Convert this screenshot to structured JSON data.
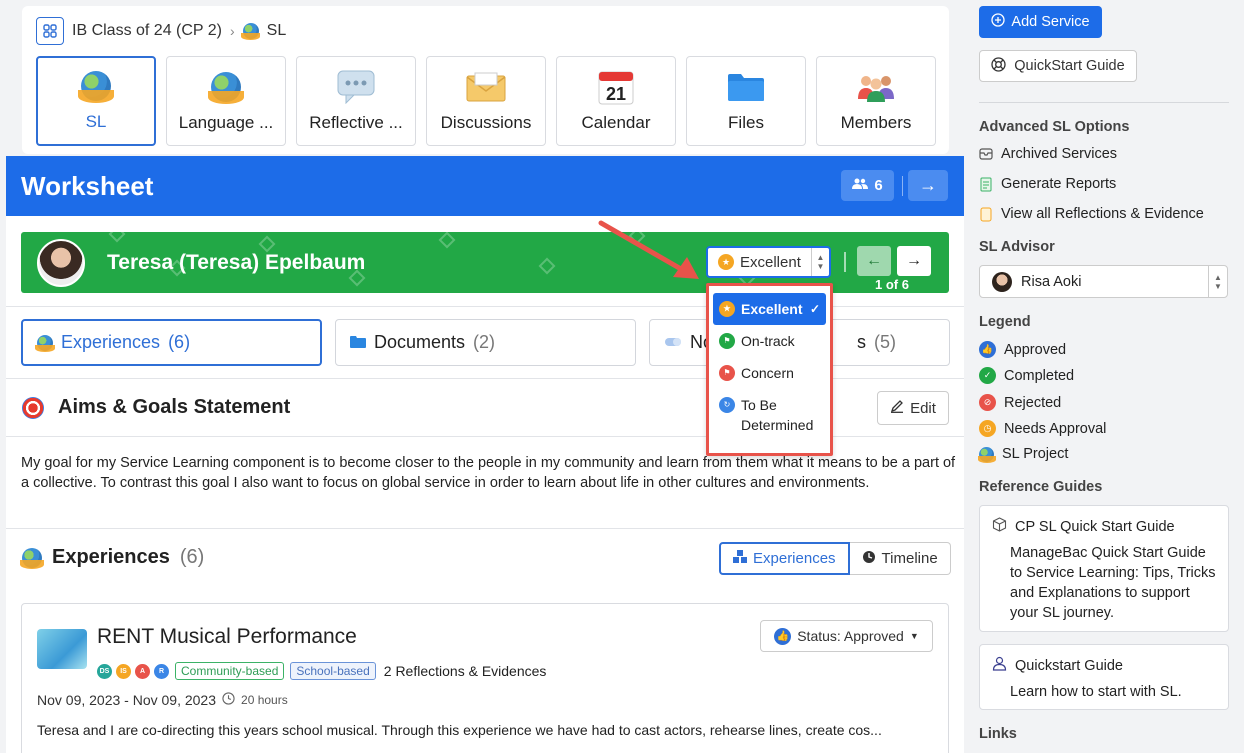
{
  "breadcrumb": {
    "class_name": "IB Class of 24 (CP 2)",
    "current": "SL"
  },
  "tabs": [
    {
      "label": "SL",
      "icon": "globe-hands-icon",
      "active": true
    },
    {
      "label": "Language ...",
      "icon": "globe-hands-icon"
    },
    {
      "label": "Reflective ...",
      "icon": "speech-bubble-icon"
    },
    {
      "label": "Discussions",
      "icon": "envelope-icon"
    },
    {
      "label": "Calendar",
      "icon": "calendar-icon",
      "calendar_day": "21"
    },
    {
      "label": "Files",
      "icon": "folder-icon"
    },
    {
      "label": "Members",
      "icon": "members-icon"
    }
  ],
  "worksheet": {
    "title": "Worksheet",
    "student_count": "6",
    "student": {
      "name": "Teresa (Teresa) Epelbaum",
      "grade_value": "Excellent",
      "pager": "1 of 6"
    },
    "subtabs": [
      {
        "label": "Experiences",
        "count": "(6)",
        "active": true
      },
      {
        "label": "Documents",
        "count": "(2)"
      },
      {
        "label": "No",
        "count": "(5)",
        "hidden_tail": "s"
      }
    ],
    "aims": {
      "title": "Aims & Goals Statement",
      "edit_label": "Edit",
      "text": "My goal for my Service Learning component is to become closer to the people in my community and learn from them what it means to be a part of a collective. To contrast this goal I also want to focus on global service in order to learn about life in other cultures and environments."
    },
    "experiences": {
      "title": "Experiences",
      "count": "(6)",
      "view_experiences": "Experiences",
      "view_timeline": "Timeline",
      "card": {
        "name": "RENT Musical Performance",
        "status": "Status: Approved",
        "initials": [
          "DS",
          "IS",
          "A",
          "R"
        ],
        "tags": [
          "Community-based",
          "School-based"
        ],
        "reflections": "2 Reflections & Evidences",
        "dates": "Nov 09, 2023 - Nov 09, 2023",
        "hours": "20 hours",
        "description": "Teresa and I are co-directing this years school musical. Through this experience we have had to cast actors, rehearse lines, create cos..."
      }
    }
  },
  "grade_dropdown": {
    "options": [
      {
        "label": "Excellent",
        "color": "#f5a623",
        "selected": true
      },
      {
        "label": "On-track",
        "color": "#22a846"
      },
      {
        "label": "Concern",
        "color": "#e8534a"
      },
      {
        "label": "To Be Determined",
        "color": "#3b86e6"
      }
    ]
  },
  "sidebar": {
    "add_service": "Add Service",
    "quickstart": "QuickStart Guide",
    "advanced_heading": "Advanced SL Options",
    "advanced_links": [
      "Archived Services",
      "Generate Reports",
      "View all Reflections & Evidence"
    ],
    "advisor_heading": "SL Advisor",
    "advisor_value": "Risa Aoki",
    "legend_heading": "Legend",
    "legend": [
      {
        "label": "Approved",
        "color": "#2f6fd6"
      },
      {
        "label": "Completed",
        "color": "#22a846"
      },
      {
        "label": "Rejected",
        "color": "#e8534a"
      },
      {
        "label": "Needs Approval",
        "color": "#f5a623"
      },
      {
        "label": "SL Project",
        "color": "#3a8fd6"
      }
    ],
    "reference_heading": "Reference Guides",
    "ref_cards": [
      {
        "title": "CP SL Quick Start Guide",
        "body": "ManageBac Quick Start Guide to Service Learning: Tips, Tricks and Explanations to support your SL journey."
      },
      {
        "title": "Quickstart Guide",
        "body": "Learn how to start with SL."
      }
    ],
    "links_heading": "Links"
  }
}
